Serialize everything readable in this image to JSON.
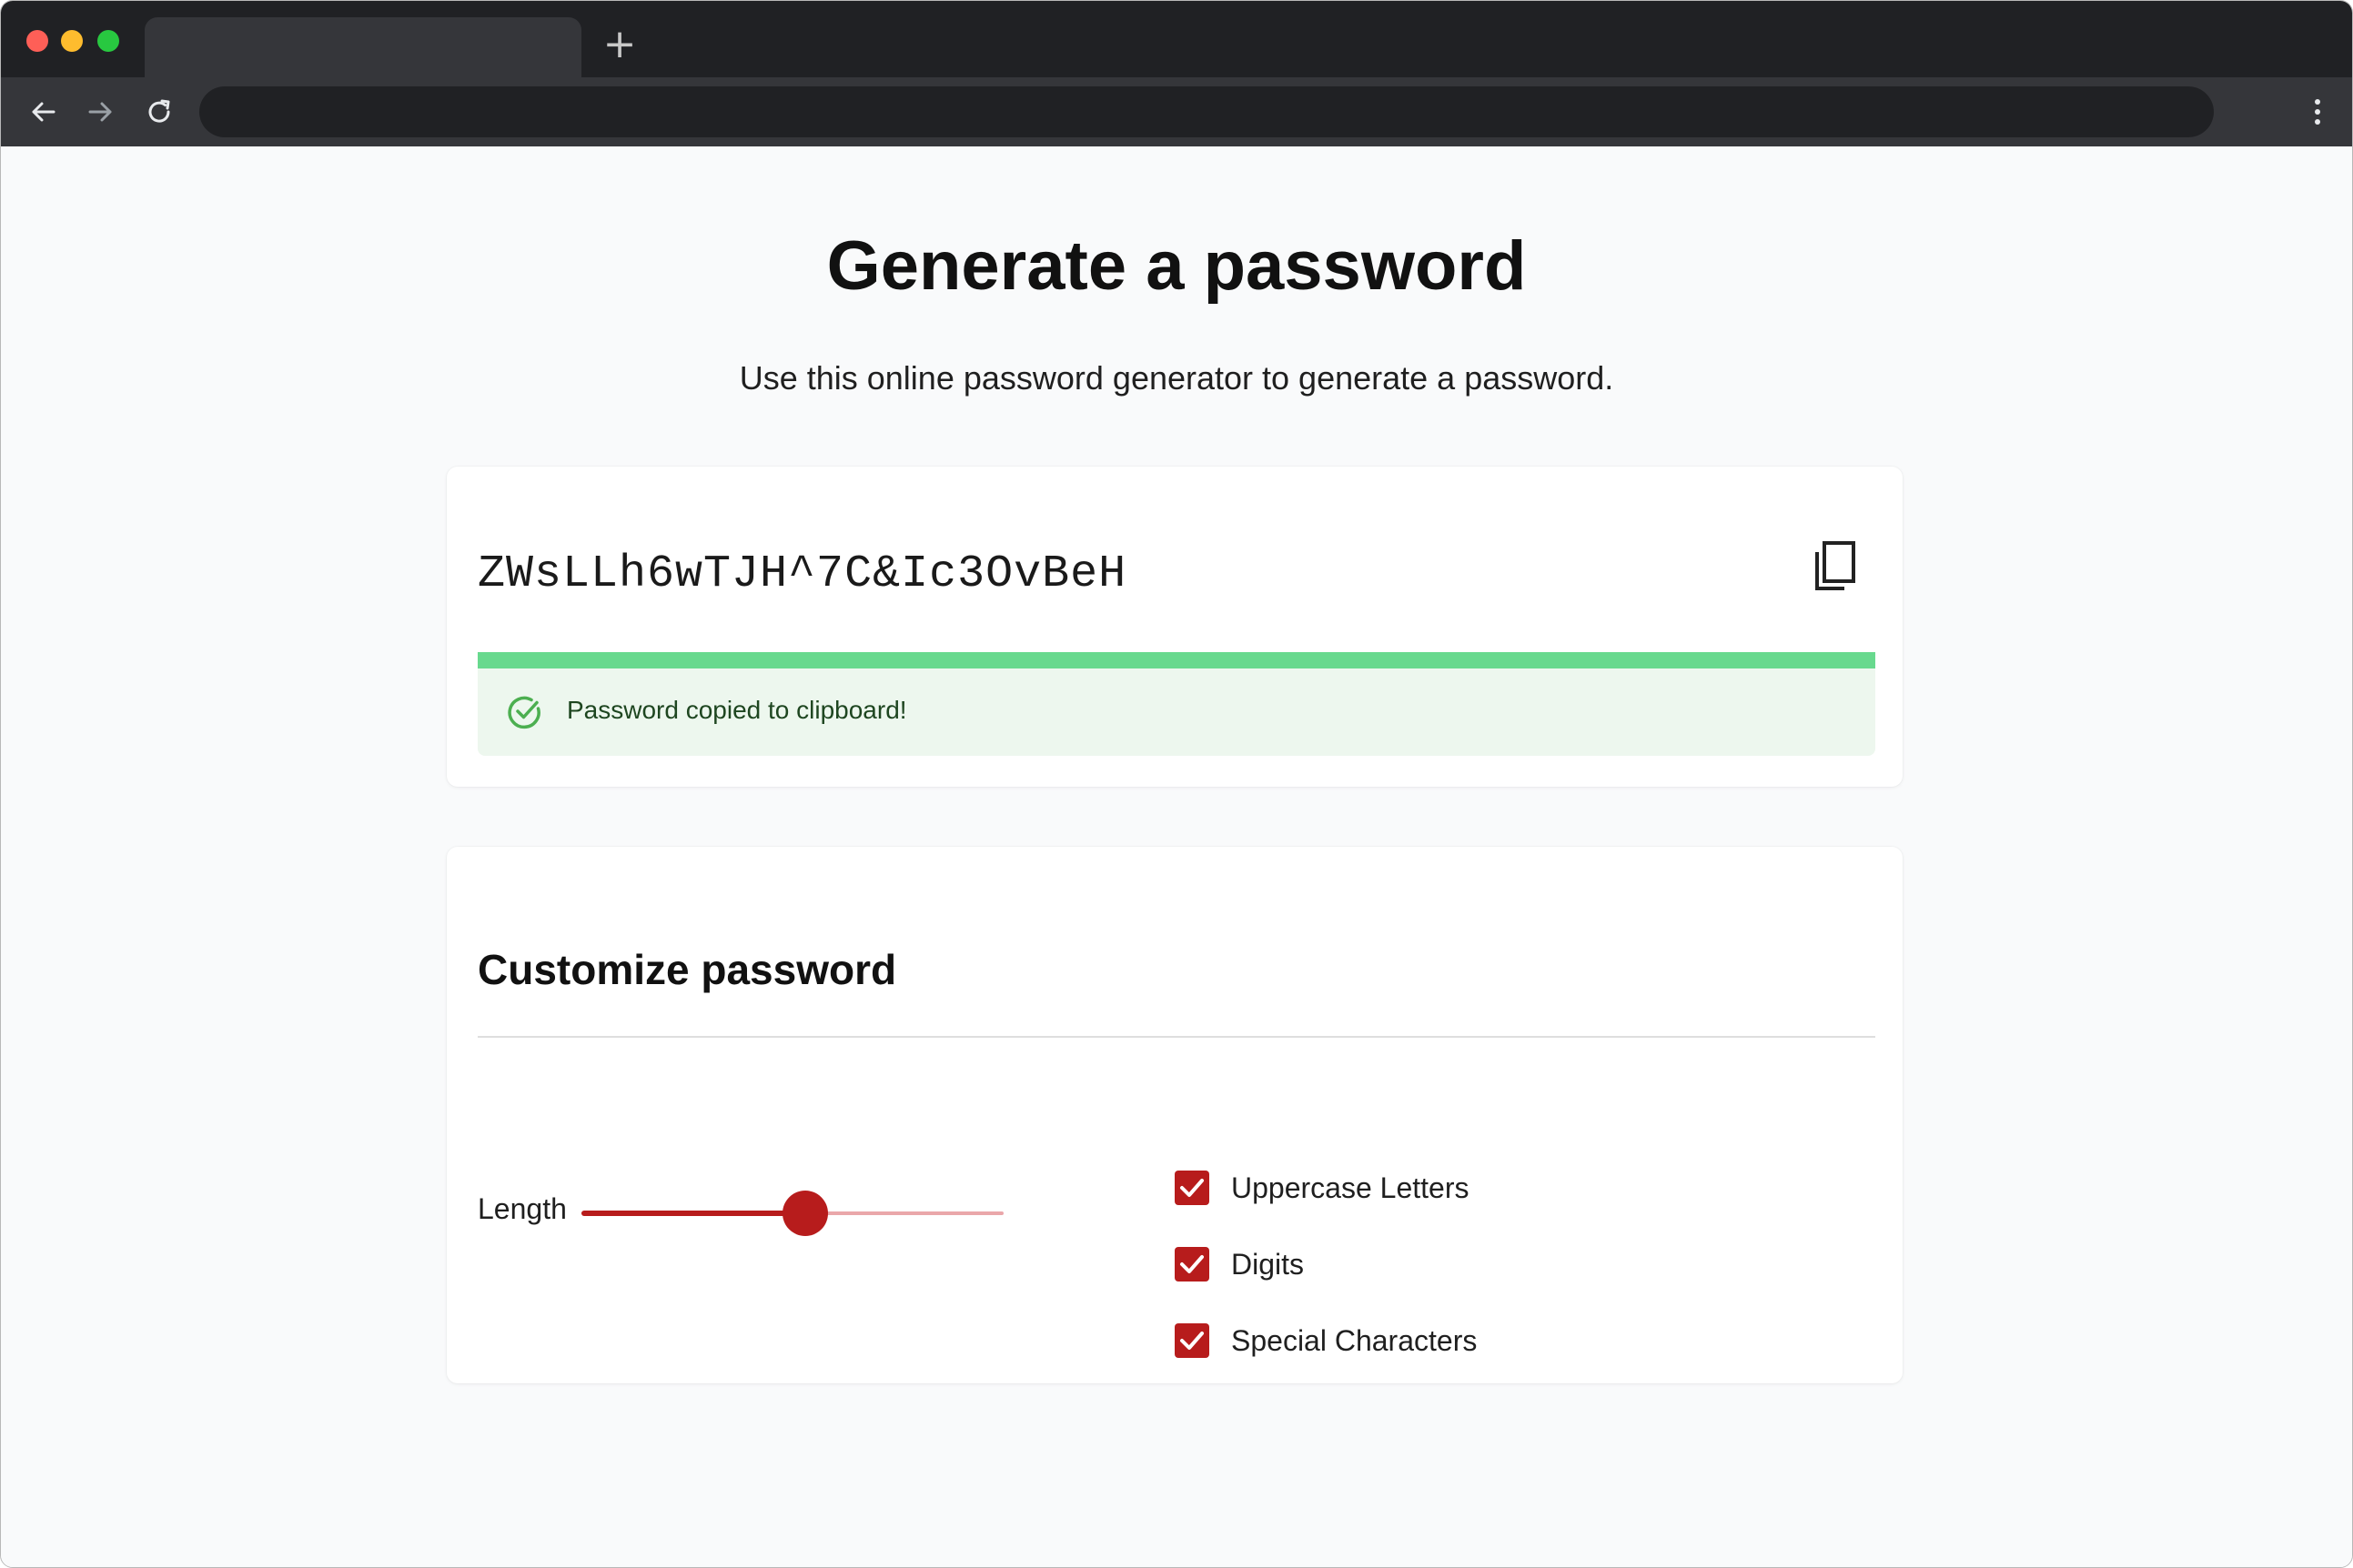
{
  "browser": {
    "new_tab_glyph": "+",
    "icons": [
      "back-arrow-icon",
      "forward-arrow-icon",
      "reload-icon",
      "more-vert-icon"
    ]
  },
  "header": {
    "title": "Generate a password",
    "subtitle": "Use this online password generator to generate a password."
  },
  "password": {
    "value": "ZWsLLh6wTJH^7C&Ic3OvBeH",
    "strength_fraction": 1.0,
    "strength_color": "#68d98e",
    "copy_icon": "content-copy-icon",
    "alert": {
      "text": "Password copied to clipboard!",
      "icon": "check-circle-icon",
      "background": "#edf7ee"
    }
  },
  "customize": {
    "title": "Customize password",
    "length": {
      "label": "Length",
      "value_fraction": 0.53
    },
    "options": [
      {
        "label": "Uppercase Letters",
        "checked": true
      },
      {
        "label": "Digits",
        "checked": true
      },
      {
        "label": "Special Characters",
        "checked": true
      }
    ],
    "accent": "#b71c1c"
  }
}
